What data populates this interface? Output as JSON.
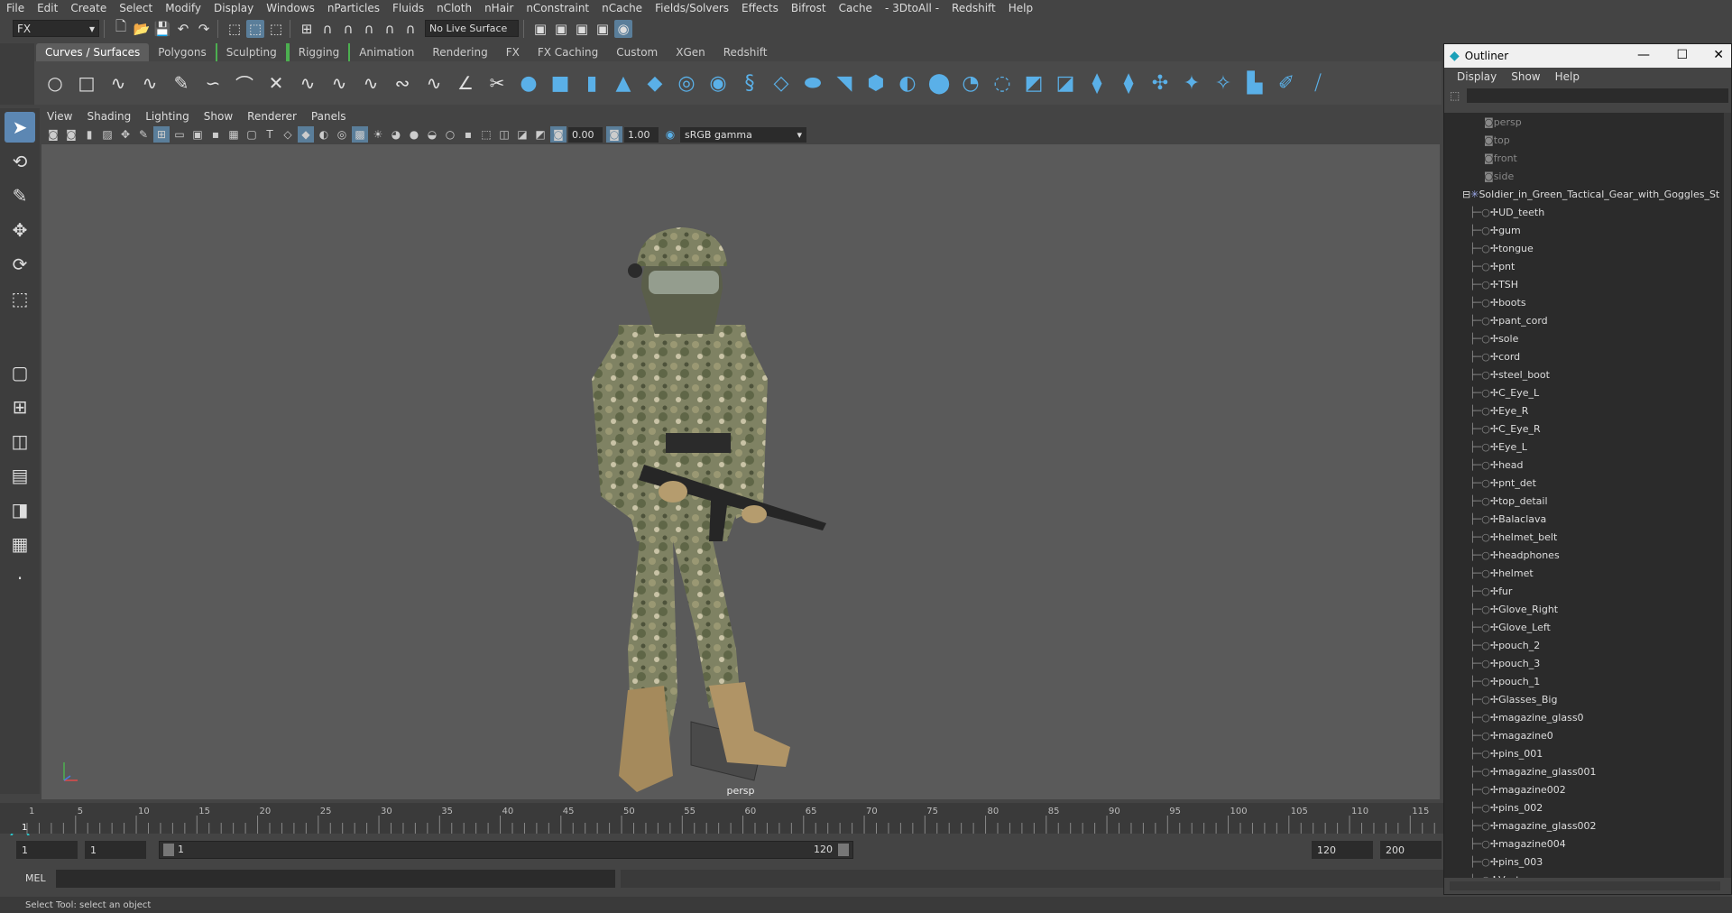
{
  "menubar": [
    "File",
    "Edit",
    "Create",
    "Select",
    "Modify",
    "Display",
    "Windows",
    "nParticles",
    "Fluids",
    "nCloth",
    "nHair",
    "nConstraint",
    "nCache",
    "Fields/Solvers",
    "Effects",
    "Bifrost",
    "Cache",
    "- 3DtoAll -",
    "Redshift",
    "Help"
  ],
  "statusline": {
    "menuset": "FX",
    "live_surface": "No Live Surface"
  },
  "shelf_tabs": [
    "Curves / Surfaces",
    "Polygons",
    "Sculpting",
    "Rigging",
    "Animation",
    "Rendering",
    "FX",
    "FX Caching",
    "Custom",
    "XGen",
    "Redshift"
  ],
  "shelf_tabs_active": "Curves / Surfaces",
  "panel_menu": [
    "View",
    "Shading",
    "Lighting",
    "Show",
    "Renderer",
    "Panels"
  ],
  "panel_toolbar": {
    "exposure": "0.00",
    "gamma": "1.00",
    "color_space": "sRGB gamma"
  },
  "viewport": {
    "camera": "persp"
  },
  "timeline": {
    "ticks": [
      "1",
      "5",
      "10",
      "15",
      "20",
      "25",
      "30",
      "35",
      "40",
      "45",
      "50",
      "55",
      "60",
      "65",
      "70",
      "75",
      "80",
      "85",
      "90",
      "95",
      "100",
      "105",
      "110",
      "115"
    ],
    "current": "1"
  },
  "range": {
    "start_frame": "1",
    "playback_start": "1",
    "slider_left": "1",
    "slider_right": "120",
    "playback_end": "120",
    "end_frame": "200"
  },
  "cmd": {
    "label": "MEL"
  },
  "help_line": "Select Tool: select an object",
  "outliner": {
    "title": "Outliner",
    "menu": [
      "Display",
      "Show",
      "Help"
    ],
    "cameras": [
      "persp",
      "top",
      "front",
      "side"
    ],
    "group": "Soldier_in_Green_Tactical_Gear_with_Goggles_St",
    "children": [
      "UD_teeth",
      "gum",
      "tongue",
      "pnt",
      "TSH",
      "boots",
      "pant_cord",
      "sole",
      "cord",
      "steel_boot",
      "C_Eye_L",
      "Eye_R",
      "C_Eye_R",
      "Eye_L",
      "head",
      "pnt_det",
      "top_detail",
      "Balaclava",
      "helmet_belt",
      "headphones",
      "helmet",
      "fur",
      "Glove_Right",
      "Glove_Left",
      "pouch_2",
      "pouch_3",
      "pouch_1",
      "Glasses_Big",
      "magazine_glass0",
      "magazine0",
      "pins_001",
      "magazine_glass001",
      "magazine002",
      "pins_002",
      "magazine_glass002",
      "magazine004",
      "pins_003",
      "Vest"
    ]
  },
  "colors": {
    "accent": "#5ab0e8",
    "active_tool": "#5c87b3",
    "viewport_bg": "#5a5a5a"
  }
}
